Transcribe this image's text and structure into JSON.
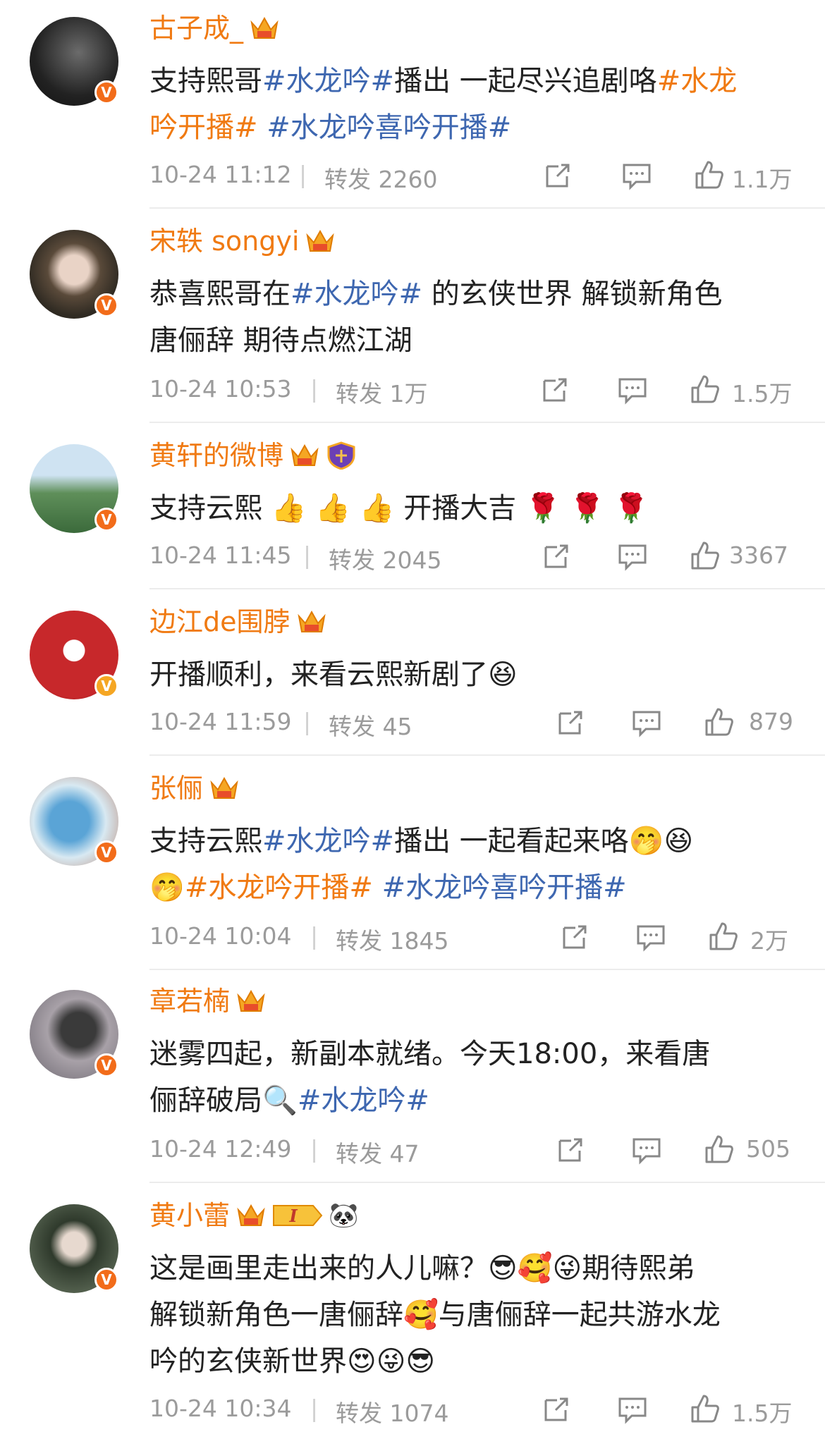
{
  "colors": {
    "name": "#f07a12",
    "topic": "#3e67b0",
    "meta": "#9b9b9b",
    "vbadge_orange": "#f26c1a",
    "vbadge_yellow": "#f5a623"
  },
  "icons": {
    "repost": "share-square-icon",
    "comment": "comment-bubble-icon",
    "like": "thumbs-up-icon",
    "member": "crown-icon"
  },
  "repost_label": "转发",
  "posts": [
    {
      "name": "古子成_",
      "segments": [
        [
          "支持熙哥",
          ""
        ],
        [
          "#水龙吟#",
          "t"
        ],
        [
          "播出 一起尽兴追剧咯",
          ""
        ],
        [
          "#水龙",
          "o"
        ]
      ],
      "segments2": [
        [
          "吟开播#",
          "o"
        ],
        [
          " ",
          ""
        ],
        [
          "#水龙吟喜吟开播#",
          "t"
        ]
      ],
      "time": "10-24 11:12",
      "reposts": "2260",
      "likes": "1.1万"
    },
    {
      "name": "宋轶 songyi",
      "segments": [
        [
          "恭喜熙哥在",
          ""
        ],
        [
          "#水龙吟#",
          "t"
        ],
        [
          " 的玄侠世界 解锁新角色",
          ""
        ]
      ],
      "segments2": [
        [
          "唐俪辞 期待点燃江湖",
          ""
        ]
      ],
      "time": "10-24 10:53",
      "reposts": "1万",
      "likes": "1.5万"
    },
    {
      "name": "黄轩的微博",
      "segments": [
        [
          "支持云熙 👍 👍 👍 开播大吉 🌹 🌹 🌹",
          ""
        ]
      ],
      "segments2": [],
      "time": "10-24 11:45",
      "reposts": "2045",
      "likes": "3367"
    },
    {
      "name": "边江de围脖",
      "segments": [
        [
          "开播顺利，来看云熙新剧了😆",
          ""
        ]
      ],
      "segments2": [],
      "time": "10-24 11:59",
      "reposts": "45",
      "likes": "879"
    },
    {
      "name": "张俪",
      "segments": [
        [
          "支持云熙",
          ""
        ],
        [
          "#水龙吟#",
          "t"
        ],
        [
          "播出 一起看起来咯🤭😆",
          ""
        ]
      ],
      "segments2": [
        [
          "🤭",
          ""
        ],
        [
          "#水龙吟开播#",
          "o"
        ],
        [
          " ",
          ""
        ],
        [
          "#水龙吟喜吟开播#",
          "t"
        ]
      ],
      "time": "10-24 10:04",
      "reposts": "1845",
      "likes": "2万"
    },
    {
      "name": "章若楠",
      "segments": [
        [
          "迷雾四起，新副本就绪。今天18:00，来看唐",
          ""
        ]
      ],
      "segments2": [
        [
          "俪辞破局🔍",
          ""
        ],
        [
          "#水龙吟#",
          "t"
        ]
      ],
      "time": "10-24 12:49",
      "reposts": "47",
      "likes": "505"
    },
    {
      "name": "黄小蕾",
      "segments": [
        [
          "这是画里走出来的人儿嘛？😎🥰😜期待熙弟",
          ""
        ]
      ],
      "segments2": [
        [
          "解锁新角色一唐俪辞🥰与唐俪辞一起共游水龙",
          ""
        ]
      ],
      "segments3": [
        [
          "吟的玄侠新世界😍😜😎",
          ""
        ]
      ],
      "time": "10-24 10:34",
      "reposts": "1074",
      "likes": "1.5万"
    }
  ]
}
